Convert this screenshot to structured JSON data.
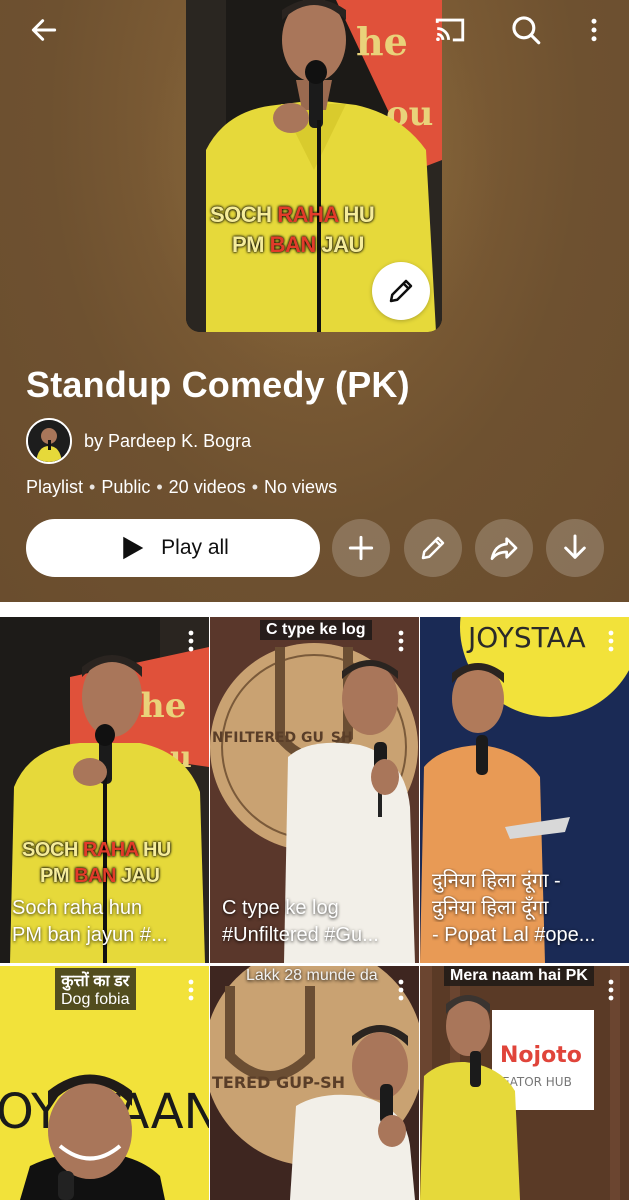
{
  "playlist": {
    "title": "Standup Comedy (PK)",
    "owner": "by Pardeep K. Bogra",
    "meta": [
      "Playlist",
      "Public",
      "20 videos",
      "No views"
    ],
    "meta_separator": "•",
    "cover_text": {
      "line1a": "SOCH",
      "line1b": "RAHA",
      "line1c": "HU",
      "line2a": "PM",
      "line2b": "BAN",
      "line2c": "JAU"
    }
  },
  "actions": {
    "play_all_label": "Play all"
  },
  "videos": [
    {
      "title_line1": "Soch raha hun",
      "title_line2": "PM ban jayun #...",
      "overlay": {
        "line1a": "SOCH",
        "line1b": "RAHA",
        "line1c": "HU",
        "line2a": "PM",
        "line2b": "BAN",
        "line2c": "JAU"
      }
    },
    {
      "title_line1": "C type ke log",
      "title_line2": "#Unfiltered #Gu...",
      "tag": "C type ke log",
      "sign": "NFILTERED GU_SH"
    },
    {
      "title_line1": "दुनिया हिला दूंगा -",
      "title_line2": "दुनिया हिला दूँगा",
      "title_line3": "- Popat Lal #ope...",
      "sign": "JOYSTAA"
    },
    {
      "tag_line1": "कुत्तों का डर",
      "tag_line2": "Dog fobia",
      "sign": "OYSTAAN"
    },
    {
      "tag": "Lakk 28 munde da",
      "sign": "TERED GUP-SH"
    },
    {
      "tag": "Mera naam hai PK",
      "sign": "Nojoto",
      "sign2": "EATOR HUB"
    }
  ],
  "colors": {
    "header_bg": "#6e5130",
    "accent_yellow": "#f2e23a",
    "shirt_orange": "#e89a55"
  }
}
